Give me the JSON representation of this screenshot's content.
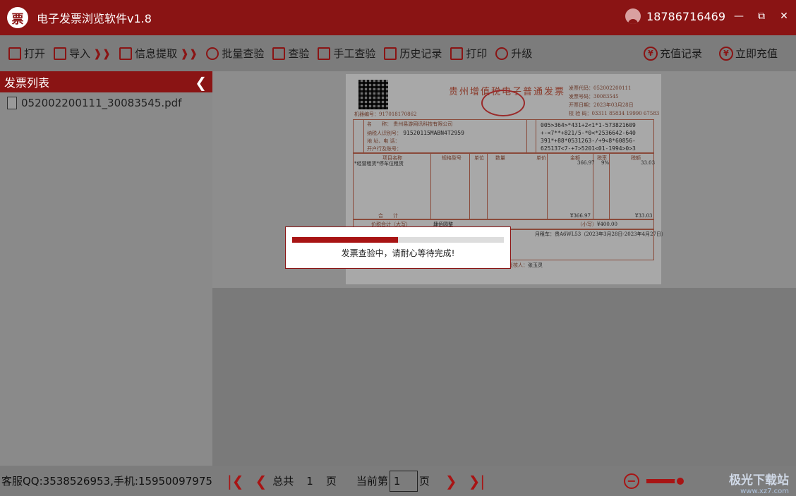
{
  "app": {
    "logo_char": "票",
    "title": "电子发票浏览软件v1.8",
    "user_phone": "18786716469",
    "window_controls": [
      "—",
      "⧉",
      "✕"
    ]
  },
  "toolbar": {
    "items": [
      {
        "label": "打开",
        "icon": "open-file-icon"
      },
      {
        "label": "导入",
        "icon": "import-icon"
      },
      {
        "label": "信息提取",
        "icon": "extract-info-icon"
      },
      {
        "label": "批量查验",
        "icon": "batch-search-icon"
      },
      {
        "label": "查验",
        "icon": "verify-icon"
      },
      {
        "label": "手工查验",
        "icon": "manual-verify-icon"
      },
      {
        "label": "历史记录",
        "icon": "history-icon"
      },
      {
        "label": "打印",
        "icon": "printer-icon"
      },
      {
        "label": "升级",
        "icon": "upgrade-icon"
      }
    ],
    "right_items": [
      {
        "label": "充值记录",
        "icon": "yen-icon"
      },
      {
        "label": "立即充值",
        "icon": "yen-icon"
      }
    ],
    "arrow_glyph": "❱❱"
  },
  "sidebar": {
    "title": "发票列表",
    "collapse_glyph": "❮",
    "files": [
      "052002200111_30083545.pdf"
    ]
  },
  "invoice": {
    "title": "贵州增值税电子普通发票",
    "machine_no_label": "机器编号：",
    "machine_no": "917018170862",
    "code_label": "发票代码：",
    "code": "052002200111",
    "number_label": "发票号码：",
    "number": "30083545",
    "date_label": "开票日期：",
    "date": "2023年03月28日",
    "check_label": "校 验 码：",
    "check_code": "03311 85834 19990 67583",
    "buyer_name_label": "名　　称：",
    "buyer_name": "贵州易游网讯科技有限公司",
    "tax_id_label": "纳税人识别号：",
    "tax_id": "91520115MABN4T2959",
    "address_label": "地 址、电 话：",
    "bank_label": "开户行及账号：",
    "cipher_lines": [
      "005>364>*431+2<1*1-573821609",
      "+-<7**+821/5-*0<*2536642-640",
      "391*+88*0531263-/+9<8*60856-",
      "625137<7-+7>5201<01-1994>0>3"
    ],
    "columns": [
      "项目名称",
      "规格型号",
      "单位",
      "数量",
      "单价",
      "金额",
      "税率",
      "税额"
    ],
    "item_name": "*经营租赁*停车位租赁",
    "amount": "366.97",
    "tax_rate": "9%",
    "tax": "33.03",
    "total_label": "合　　计",
    "total_amount": "¥366.97",
    "total_tax": "¥33.03",
    "grand_label": "价税合计（大写）",
    "grand_words": "肆佰圆整",
    "grand_small_label": "（小写）",
    "grand_small": "¥400.00",
    "remark": "月租车：贵A6WL53（2023年3月28日-2023年4月27日）",
    "payee_label": "复核人：",
    "payee": "张玉灵"
  },
  "dialog": {
    "progress": 0.5,
    "message": "发票查验中，请耐心等待完成!"
  },
  "footer": {
    "support": "客服QQ:3538526953,手机:15950097975",
    "total_label": "总共",
    "total_pages": "1",
    "page_unit": "页",
    "current_label": "当前第",
    "current_page": "1",
    "current_unit": "页",
    "zoom_out": "−",
    "zoom_in": "+",
    "zoom_level": 0.85
  },
  "watermark": {
    "text": "极光下载站",
    "url": "www.xz7.com"
  },
  "colors": {
    "brand": "#8a1414",
    "accent": "#a81414"
  }
}
